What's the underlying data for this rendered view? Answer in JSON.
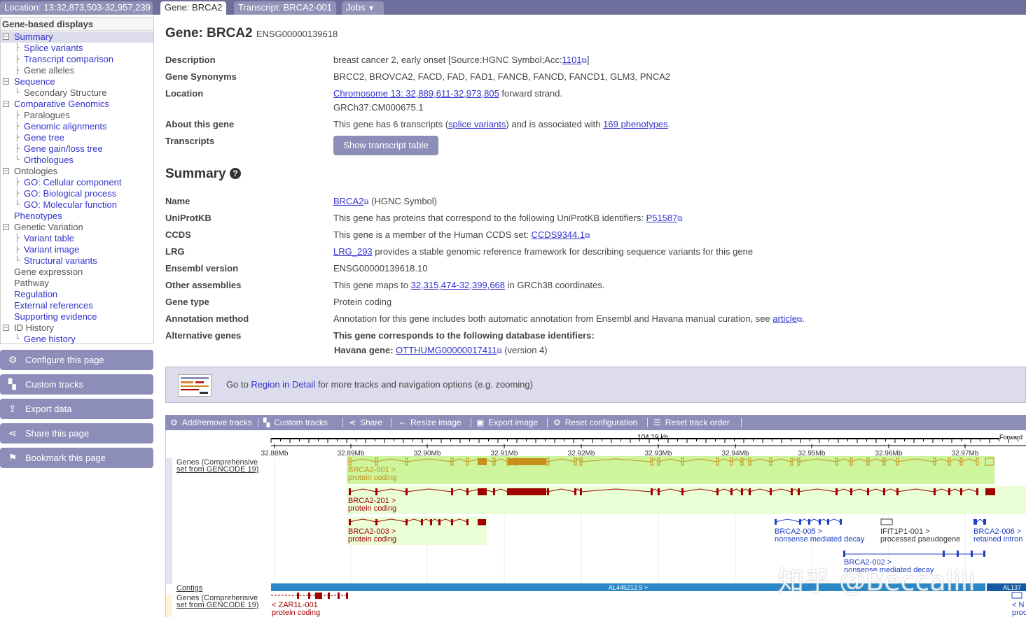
{
  "tabs": {
    "location": "Location: 13:32,873,503-32,957,239",
    "gene": "Gene: BRCA2",
    "transcript": "Transcript: BRCA2-001",
    "jobs": "Jobs"
  },
  "sidebar": {
    "title": "Gene-based displays",
    "items": [
      {
        "label": "Summary",
        "level": 0,
        "toggle": "⊟",
        "selected": true,
        "link": true
      },
      {
        "label": "Splice variants",
        "level": 1,
        "link": true
      },
      {
        "label": "Transcript comparison",
        "level": 1,
        "link": true
      },
      {
        "label": "Gene alleles",
        "level": 1,
        "link": false
      },
      {
        "label": "Sequence",
        "level": 0,
        "toggle": "⊟",
        "link": true
      },
      {
        "label": "Secondary Structure",
        "level": 1,
        "last": true,
        "link": false
      },
      {
        "label": "Comparative Genomics",
        "level": 0,
        "toggle": "⊟",
        "link": true
      },
      {
        "label": "Paralogues",
        "level": 1,
        "link": false
      },
      {
        "label": "Genomic alignments",
        "level": 1,
        "link": true
      },
      {
        "label": "Gene tree",
        "level": 1,
        "link": true
      },
      {
        "label": "Gene gain/loss tree",
        "level": 1,
        "link": true
      },
      {
        "label": "Orthologues",
        "level": 1,
        "last": true,
        "link": true
      },
      {
        "label": "Ontologies",
        "level": 0,
        "toggle": "⊟",
        "link": false
      },
      {
        "label": "GO: Cellular component",
        "level": 1,
        "link": true
      },
      {
        "label": "GO: Biological process",
        "level": 1,
        "link": true
      },
      {
        "label": "GO: Molecular function",
        "level": 1,
        "last": true,
        "link": true
      },
      {
        "label": "Phenotypes",
        "level": 0,
        "link": true
      },
      {
        "label": "Genetic Variation",
        "level": 0,
        "toggle": "⊟",
        "link": false
      },
      {
        "label": "Variant table",
        "level": 1,
        "link": true
      },
      {
        "label": "Variant image",
        "level": 1,
        "link": true
      },
      {
        "label": "Structural variants",
        "level": 1,
        "last": true,
        "link": true
      },
      {
        "label": "Gene expression",
        "level": 0,
        "link": false
      },
      {
        "label": "Pathway",
        "level": 0,
        "link": false
      },
      {
        "label": "Regulation",
        "level": 0,
        "link": true
      },
      {
        "label": "External references",
        "level": 0,
        "link": true
      },
      {
        "label": "Supporting evidence",
        "level": 0,
        "link": true
      },
      {
        "label": "ID History",
        "level": 0,
        "toggle": "⊟",
        "link": false
      },
      {
        "label": "Gene history",
        "level": 1,
        "last": true,
        "link": true
      }
    ],
    "buttons": [
      {
        "label": "Configure this page",
        "icon": "gear-icon",
        "glyph": "⚙"
      },
      {
        "label": "Custom tracks",
        "icon": "custom-tracks-icon",
        "glyph": "▚"
      },
      {
        "label": "Export data",
        "icon": "export-icon",
        "glyph": "⇪"
      },
      {
        "label": "Share this page",
        "icon": "share-icon",
        "glyph": "⋖"
      },
      {
        "label": "Bookmark this page",
        "icon": "bookmark-icon",
        "glyph": "⚑"
      }
    ]
  },
  "gene": {
    "title": "Gene: BRCA2",
    "id": "ENSG00000139618",
    "description_label": "Description",
    "description": "breast cancer 2, early onset [Source:HGNC Symbol;Acc:",
    "description_acc": "1101",
    "description_end": "]",
    "synonyms_label": "Gene Synonyms",
    "synonyms": "BRCC2, BROVCA2, FACD, FAD, FAD1, FANCB, FANCD, FANCD1, GLM3, PNCA2",
    "location_label": "Location",
    "location_link": "Chromosome 13: 32,889,611-32,973,805",
    "location_strand": " forward strand.",
    "location_assembly": "GRCh37:CM000675.1",
    "about_label": "About this gene",
    "about_pre": "This gene has 6 transcripts (",
    "about_link1": "splice variants",
    "about_mid": ") and is associated with ",
    "about_link2": "169 phenotypes",
    "about_end": ".",
    "transcripts_label": "Transcripts",
    "show_table_button": "Show transcript table"
  },
  "summary": {
    "heading": "Summary",
    "help_glyph": "?",
    "name_label": "Name",
    "name_link": "BRCA2",
    "name_suffix": " (HGNC Symbol)",
    "uniprot_label": "UniProtKB",
    "uniprot_pre": "This gene has proteins that correspond to the following UniProtKB identifiers: ",
    "uniprot_link": "P51587",
    "ccds_label": "CCDS",
    "ccds_pre": "This gene is a member of the Human CCDS set: ",
    "ccds_link": "CCDS9344.1",
    "lrg_label": "LRG",
    "lrg_link": "LRG_293",
    "lrg_text": " provides a stable genomic reference framework for describing sequence variants for this gene",
    "version_label": "Ensembl version",
    "version": "ENSG00000139618.10",
    "assemblies_label": "Other assemblies",
    "assemblies_pre": "This gene maps to ",
    "assemblies_link": "32,315,474-32,399,668",
    "assemblies_end": " in GRCh38 coordinates.",
    "type_label": "Gene type",
    "type": "Protein coding",
    "annotation_label": "Annotation method",
    "annotation_pre": "Annotation for this gene includes both automatic annotation from Ensembl and Havana manual curation, see ",
    "annotation_link": "article",
    "annotation_end": ".",
    "alt_label": "Alternative genes",
    "alt_heading": "This gene corresponds to the following database identifiers:",
    "havana_label": "Havana gene:",
    "havana_link": "OTTHUMG00000017411",
    "havana_end": " (version 4)"
  },
  "banner": {
    "pre": "Go to ",
    "link": "Region in Detail",
    "post": " for more tracks and navigation options (e.g. zooming)"
  },
  "toolbar": [
    {
      "label": "Add/remove tracks",
      "icon": "gear-icon",
      "glyph": "⚙"
    },
    {
      "label": "Custom tracks",
      "icon": "custom-tracks-icon",
      "glyph": "▚"
    },
    {
      "label": "Share",
      "icon": "share-icon",
      "glyph": "⋖"
    },
    {
      "label": "Resize image",
      "icon": "resize-icon",
      "glyph": "⇔"
    },
    {
      "label": "Export image",
      "icon": "image-icon",
      "glyph": "▣"
    },
    {
      "label": "Reset configuration",
      "icon": "reset-config-icon",
      "glyph": "⚙"
    },
    {
      "label": "Reset track order",
      "icon": "reset-order-icon",
      "glyph": "☰"
    }
  ],
  "image": {
    "scale_label": "104.19 kb",
    "strand_label": "Forward",
    "ticks": [
      "32.88Mb",
      "32.89Mb",
      "32.90Mb",
      "32.91Mb",
      "32.92Mb",
      "32.93Mb",
      "32.94Mb",
      "32.95Mb",
      "32.96Mb",
      "32.97Mb"
    ],
    "track_genes": "Genes (Comprehensive set from GENCODE 19)",
    "track_genes_line1": "Genes (Comprehensive",
    "track_genes_line2": "set from GENCODE 19)",
    "track_contigs": "Contigs",
    "contig1": "AL445212.9 >",
    "contig2": "AL137",
    "transcripts": [
      {
        "name": "BRCA2-001 >",
        "biotype": "protein coding",
        "color": "#c8901a"
      },
      {
        "name": "BRCA2-201 >",
        "biotype": "protein coding",
        "color": "#a00000"
      },
      {
        "name": "BRCA2-003 >",
        "biotype": "protein coding",
        "color": "#a00000"
      },
      {
        "name": "BRCA2-005 >",
        "biotype": "nonsense mediated decay",
        "color": "#1f40c0"
      },
      {
        "name": "IFIT1P1-001 >",
        "biotype": "processed pseudogene",
        "color": "#333333"
      },
      {
        "name": "BRCA2-006 >",
        "biotype": "retained intron",
        "color": "#1f40c0"
      },
      {
        "name": "BRCA2-002 >",
        "biotype": "nonsense mediated decay",
        "color": "#1f40c0"
      }
    ],
    "reverse_gene": {
      "name": "< ZAR1L-001",
      "biotype": "protein coding"
    },
    "reverse_gene2": {
      "name": "< N",
      "biotype": "proc"
    }
  },
  "watermark": "知乎 @Beccalili",
  "colors": {
    "nav": "#6e6e9c",
    "button": "#8d8db9",
    "link": "#3333cc",
    "highlight": "#dcdcec"
  }
}
